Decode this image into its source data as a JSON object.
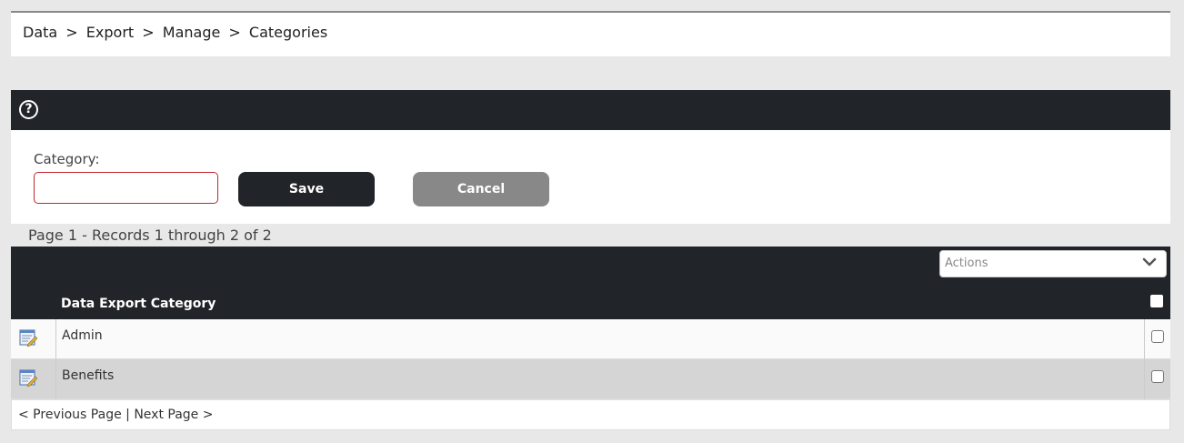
{
  "breadcrumb": {
    "items": [
      "Data",
      "Export",
      "Manage",
      "Categories"
    ],
    "separator": ">"
  },
  "help_bar": {
    "icon": "help-circle-icon"
  },
  "form": {
    "category_label": "Category:",
    "category_value": "",
    "category_placeholder": "",
    "save_label": "Save",
    "cancel_label": "Cancel"
  },
  "records_info": "Page 1 - Records 1 through 2 of 2",
  "grid": {
    "actions_placeholder": "Actions",
    "column_title": "Data Export Category",
    "rows": [
      {
        "name": "Admin"
      },
      {
        "name": "Benefits"
      }
    ]
  },
  "pager": {
    "previous_label": "< Previous Page",
    "divider": "|",
    "next_label": "Next Page >"
  },
  "colors": {
    "header_dark": "#212429",
    "cancel_gray": "#888888",
    "input_border_error": "#c0262d"
  }
}
